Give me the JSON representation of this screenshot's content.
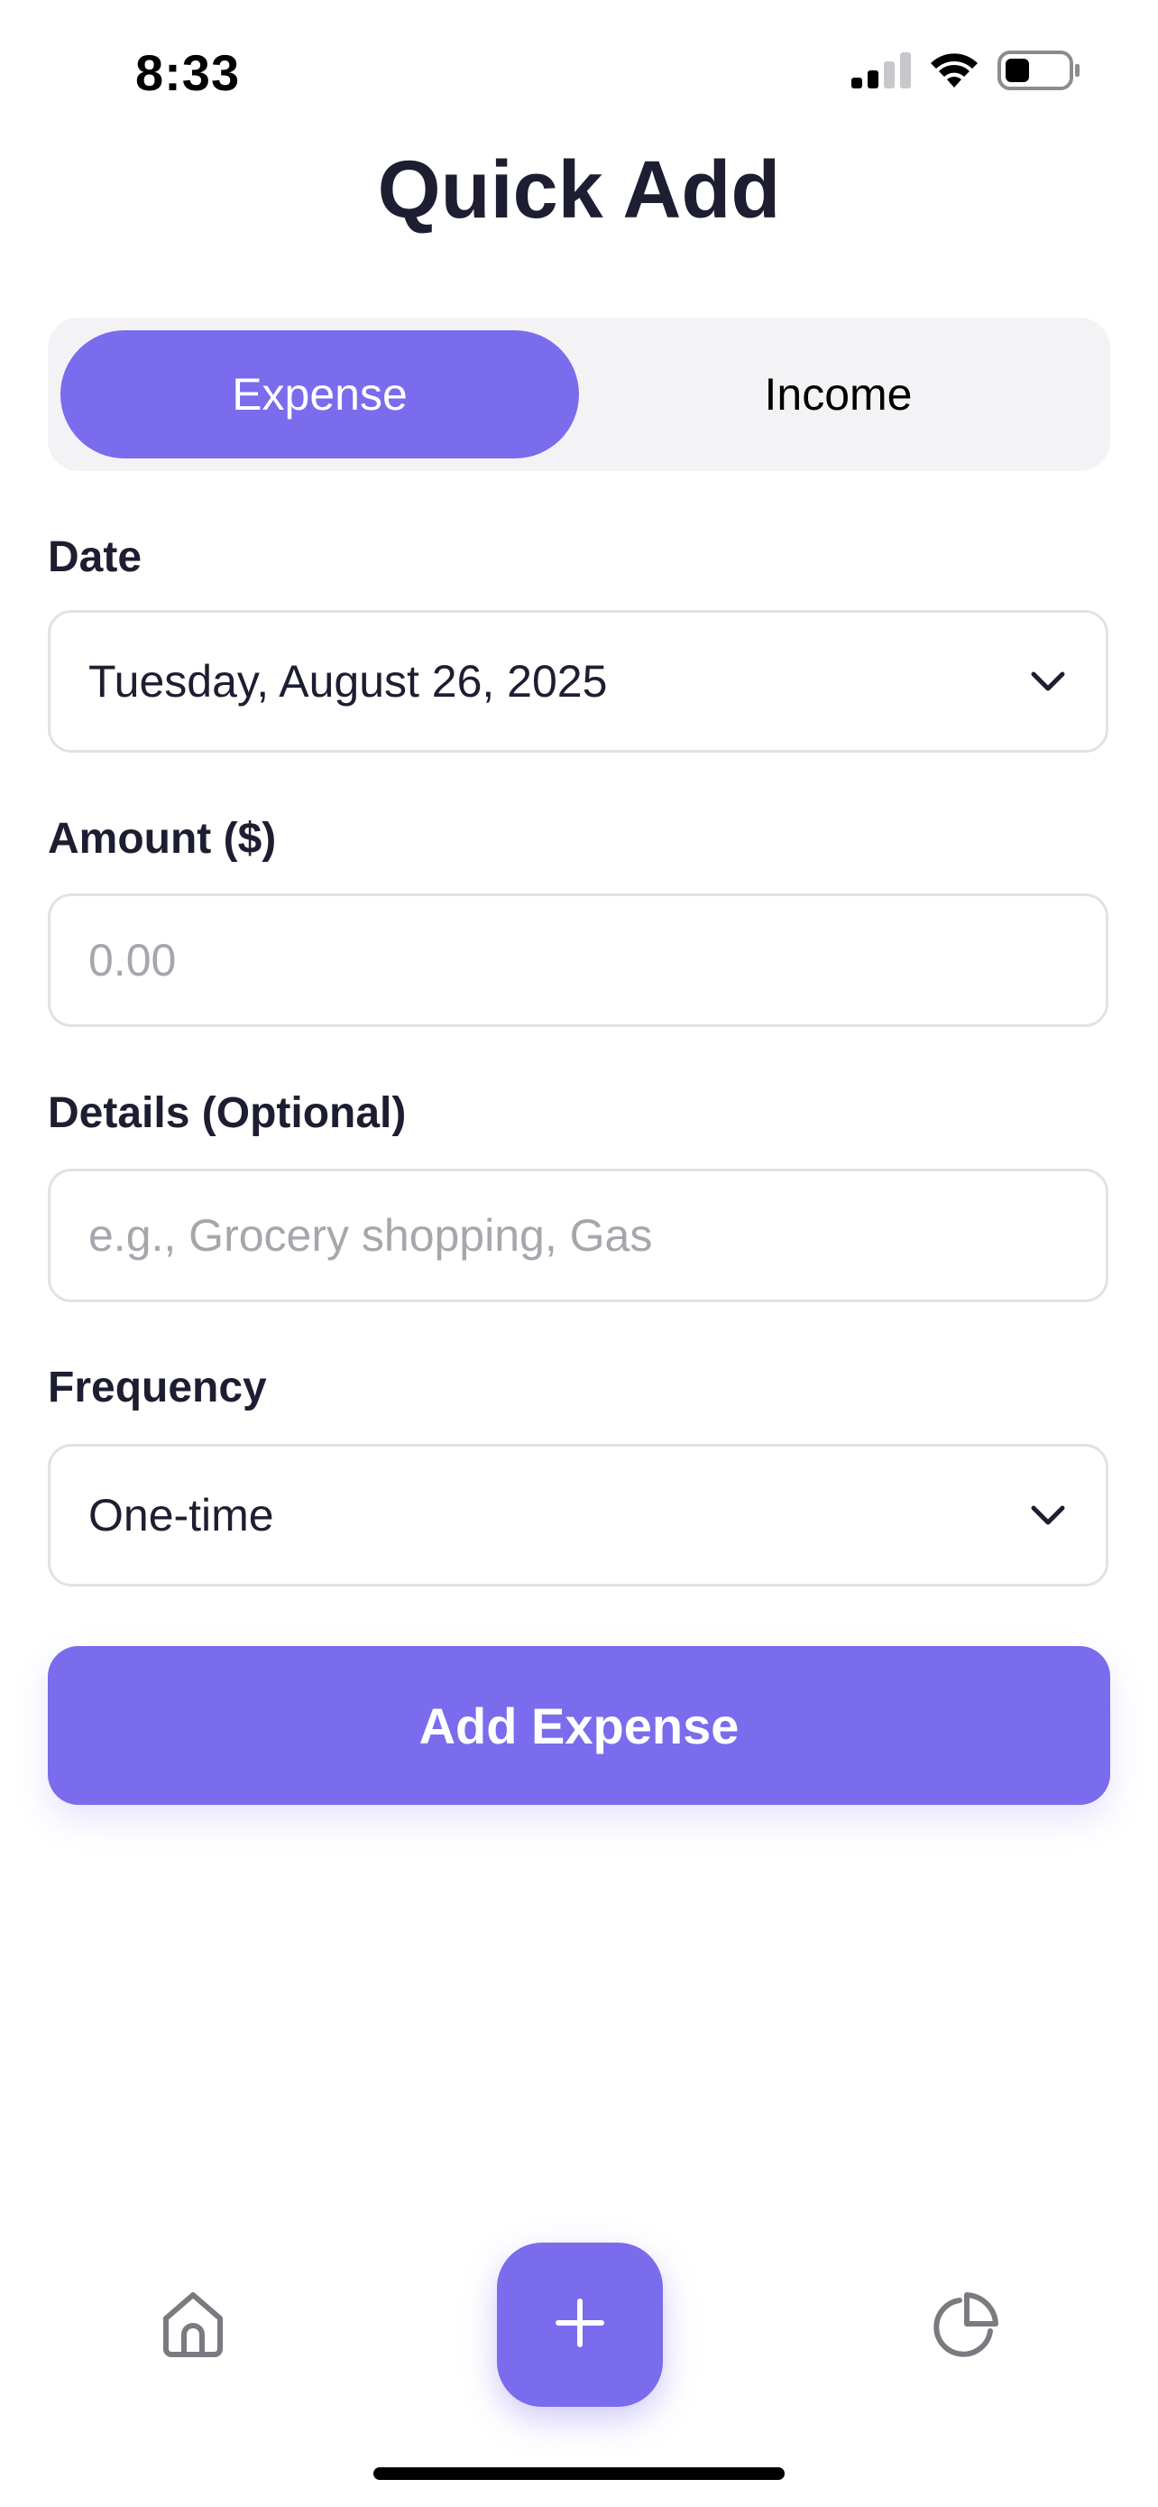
{
  "status_bar": {
    "time": "8:33",
    "icons": [
      "cellular-signal-icon",
      "wifi-icon",
      "battery-icon"
    ]
  },
  "title": "Quick Add",
  "segment": {
    "options": [
      "Expense",
      "Income"
    ],
    "selected": "Expense"
  },
  "form": {
    "date": {
      "label": "Date",
      "value": "Tuesday, August 26, 2025"
    },
    "amount": {
      "label": "Amount ($)",
      "placeholder": "0.00",
      "value": ""
    },
    "details": {
      "label": "Details (Optional)",
      "placeholder": "e.g., Grocery shopping, Gas",
      "value": ""
    },
    "frequency": {
      "label": "Frequency",
      "value": "One-time"
    }
  },
  "submit_label": "Add Expense",
  "tab_bar": {
    "items": [
      "home-icon",
      "plus-icon",
      "pie-chart-icon"
    ]
  },
  "colors": {
    "accent": "#7B6BED",
    "text": "#1E1E32",
    "placeholder": "#A6A6AD",
    "field_border": "#E1E1E6",
    "segment_bg": "#F3F3F6"
  }
}
